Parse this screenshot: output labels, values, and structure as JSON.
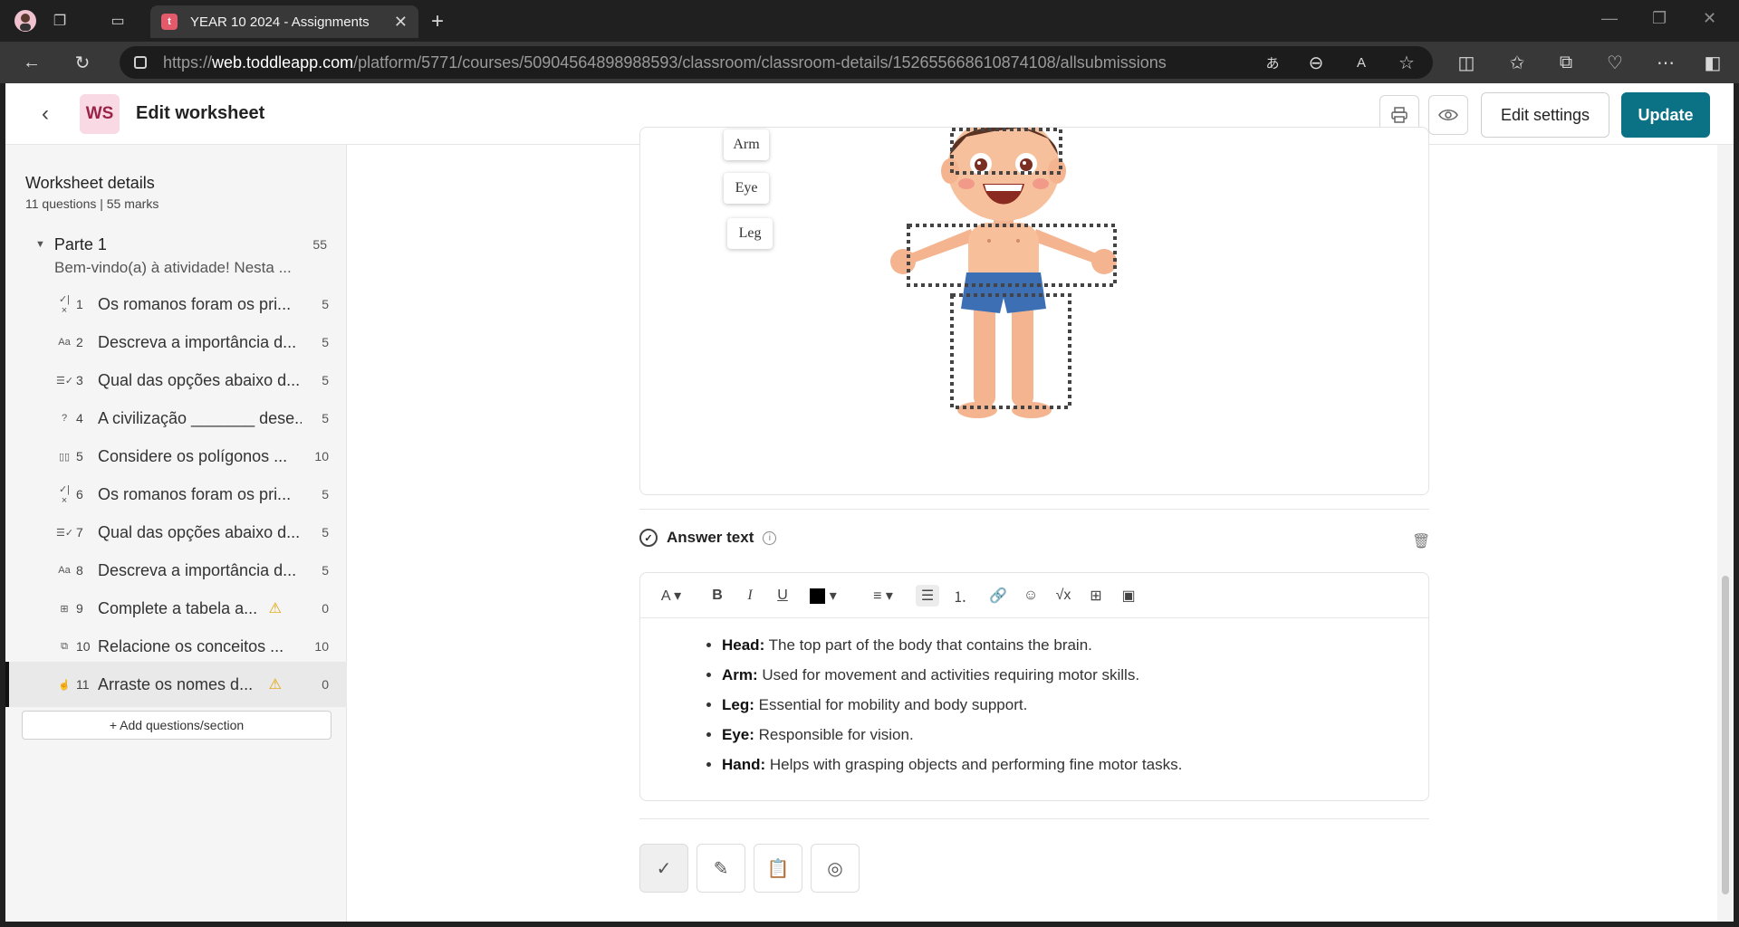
{
  "browser": {
    "tab_title": "YEAR 10 2024 - Assignments",
    "tab_favicon": "t",
    "url_prefix": "https://",
    "url_host": "web.toddleapp.com",
    "url_path": "/platform/5771/courses/50904564898988593/classroom/classroom-details/152655668610874108/allsubmissions"
  },
  "header": {
    "badge": "WS",
    "title": "Edit worksheet",
    "edit_settings": "Edit settings",
    "update": "Update"
  },
  "sidebar": {
    "title": "Worksheet details",
    "subtitle": "11 questions | 55 marks",
    "section": {
      "name": "Parte 1",
      "marks": "55"
    },
    "intro": "Bem-vindo(a) à atividade! Nesta ...",
    "questions": [
      {
        "num": "1",
        "icon": "✓|×",
        "text": "Os romanos foram os pri...",
        "marks": "5",
        "warn": ""
      },
      {
        "num": "2",
        "icon": "Aa",
        "text": "Descreva a importância d...",
        "marks": "5",
        "warn": ""
      },
      {
        "num": "3",
        "icon": "☰✓",
        "text": "Qual das opções abaixo d...",
        "marks": "5",
        "warn": ""
      },
      {
        "num": "4",
        "icon": "?",
        "text": "A civilização _______ dese...",
        "marks": "5",
        "warn": ""
      },
      {
        "num": "5",
        "icon": "▯▯",
        "text": "Considere os polígonos ...",
        "marks": "10",
        "warn": ""
      },
      {
        "num": "6",
        "icon": "✓|×",
        "text": "Os romanos foram os pri...",
        "marks": "5",
        "warn": ""
      },
      {
        "num": "7",
        "icon": "☰✓",
        "text": "Qual das opções abaixo d...",
        "marks": "5",
        "warn": ""
      },
      {
        "num": "8",
        "icon": "Aa",
        "text": "Descreva a importância d...",
        "marks": "5",
        "warn": ""
      },
      {
        "num": "9",
        "icon": "⊞",
        "text": "Complete a tabela a...",
        "marks": "0",
        "warn": "⚠"
      },
      {
        "num": "10",
        "icon": "⧉",
        "text": "Relacione os conceitos ...",
        "marks": "10",
        "warn": ""
      },
      {
        "num": "11",
        "icon": "☝",
        "text": "Arraste os nomes d...",
        "marks": "0",
        "warn": "⚠"
      }
    ],
    "add_button": "Add questions/section"
  },
  "question": {
    "drag_labels": [
      "Arm",
      "Eye",
      "Leg"
    ]
  },
  "answer": {
    "title": "Answer text",
    "items": [
      {
        "term": "Head:",
        "desc": " The top part of the body that contains the brain."
      },
      {
        "term": "Arm:",
        "desc": " Used for movement and activities requiring motor skills."
      },
      {
        "term": "Leg:",
        "desc": " Essential for mobility and body support."
      },
      {
        "term": "Eye:",
        "desc": " Responsible for vision."
      },
      {
        "term": "Hand:",
        "desc": " Helps with grasping objects and performing fine motor tasks."
      }
    ]
  },
  "colors": {
    "accent": "#0b7285",
    "badge_bg": "#f9d9e3",
    "warning": "#e2a100"
  }
}
